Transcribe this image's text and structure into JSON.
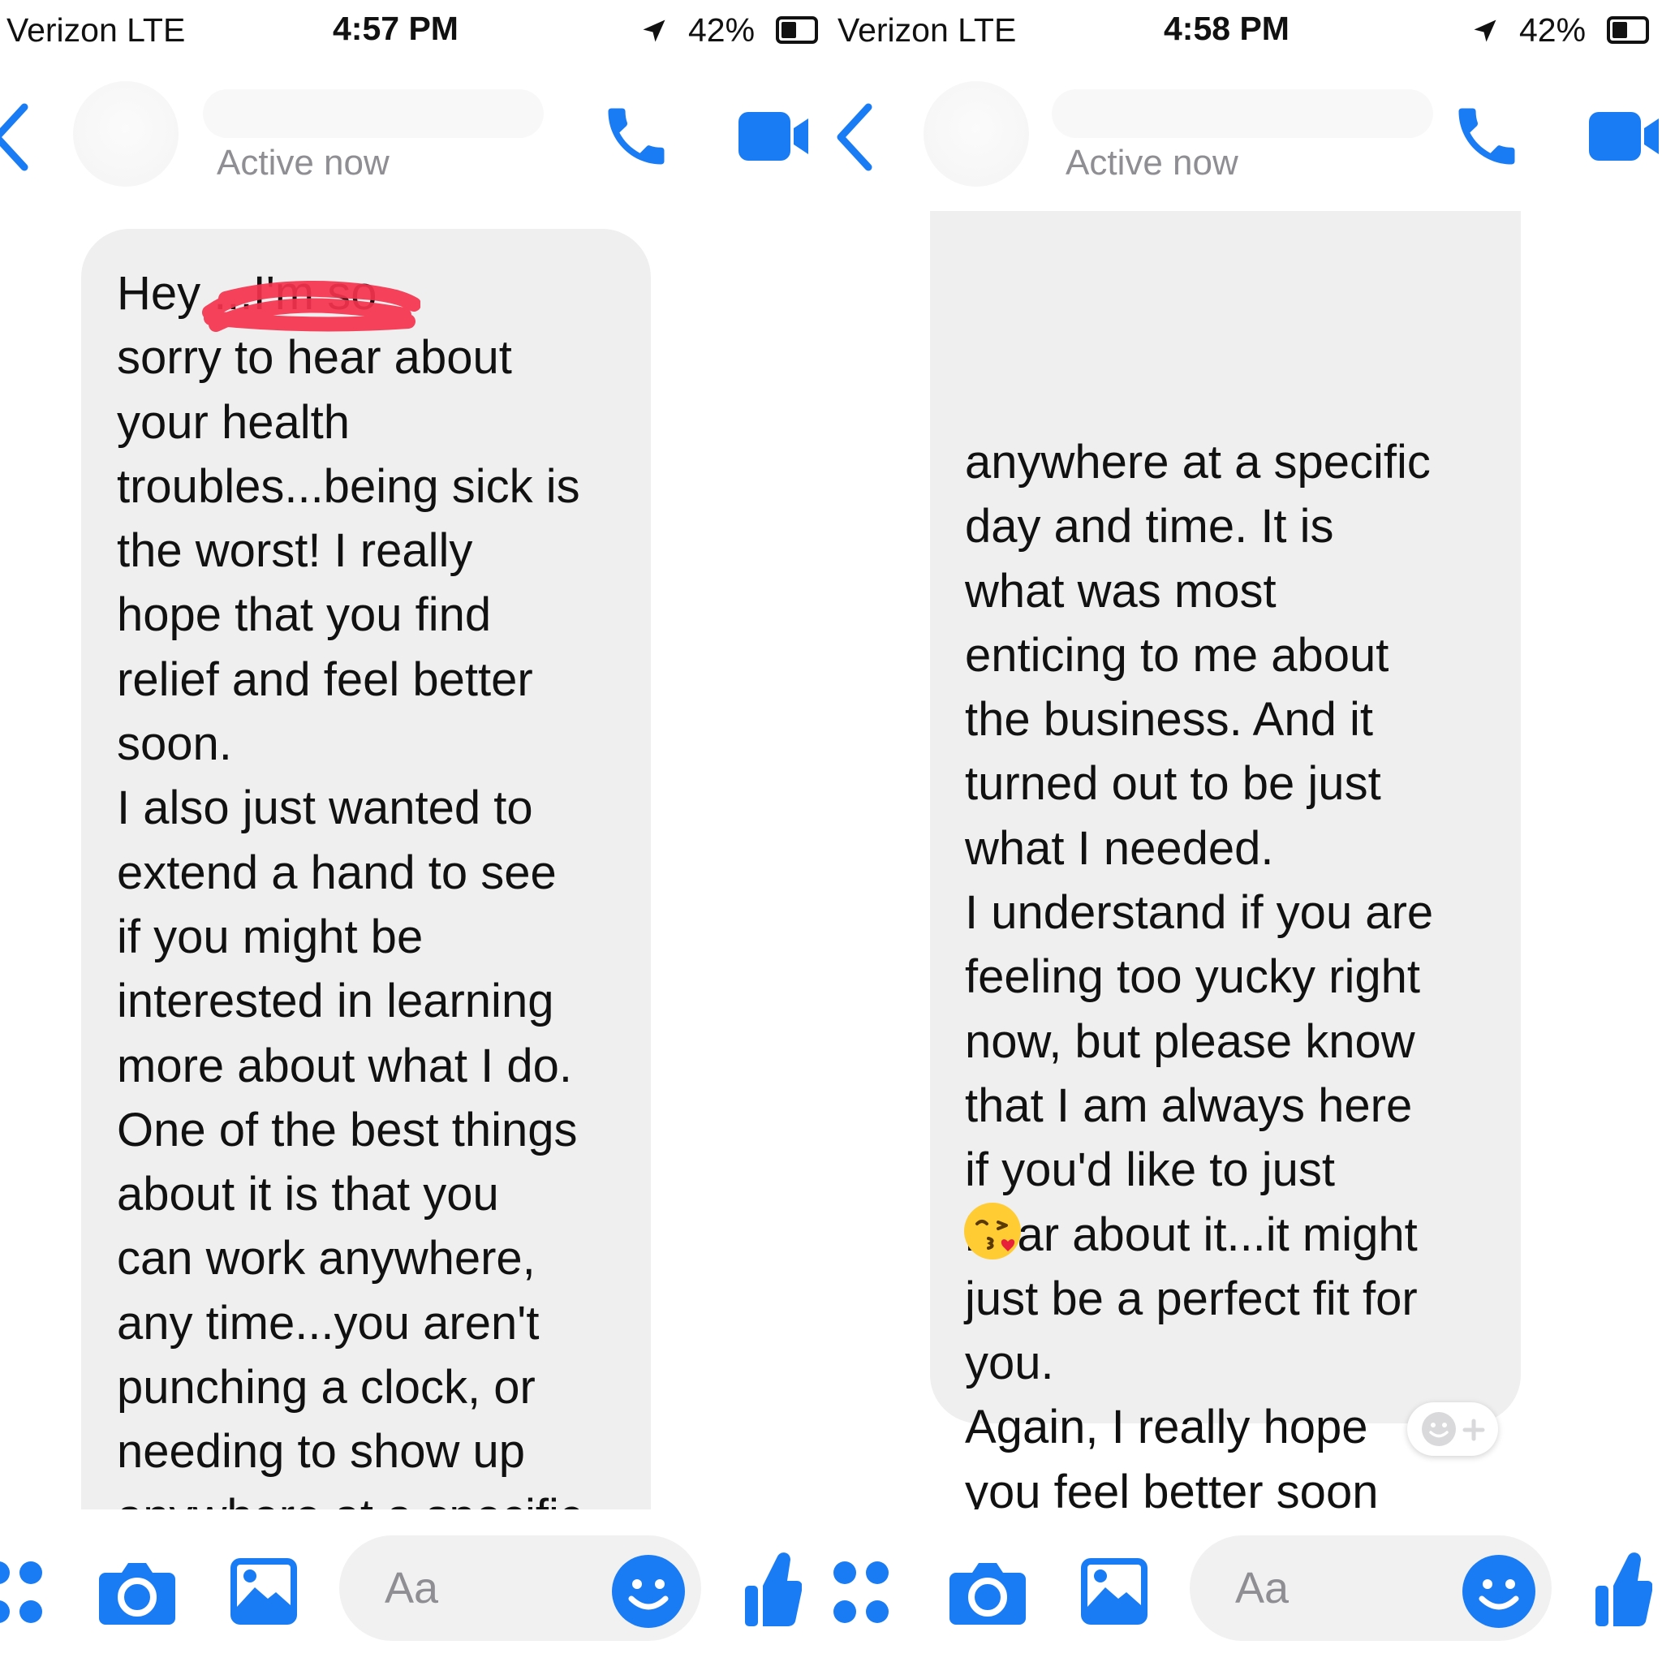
{
  "colors": {
    "accent": "#1a7cf5",
    "bubble": "#efefef",
    "muted": "#8e8e93"
  },
  "screens": [
    {
      "statusbar": {
        "carrier": "Verizon  LTE",
        "time": "4:57 PM",
        "battery": "42%"
      },
      "header": {
        "status": "Active now"
      },
      "message": {
        "text": "Hey         ...I'm so\nsorry to hear about\nyour health\ntroubles...being sick is\nthe worst! I really\nhope that you find\nrelief and feel better\nsoon.\nI also just wanted to\nextend a hand to see\nif you might be\ninterested in learning\nmore about what I do.\nOne of the best things\nabout it is that you\ncan work anywhere,\nany time...you aren't\npunching a clock, or\nneeding to show up\nanywhere at a specific"
      },
      "composer": {
        "placeholder": "Aa"
      }
    },
    {
      "statusbar": {
        "carrier": "Verizon  LTE",
        "time": "4:58 PM",
        "battery": "42%"
      },
      "header": {
        "status": "Active now"
      },
      "message": {
        "text": "anywhere at a specific\nday and time. It is\nwhat was most\nenticing to me about\nthe business. And it\nturned out to be just\nwhat I needed.\nI understand if you are\nfeeling too yucky right\nnow, but please know\nthat I am always here\nif you'd like to just\nhear about it...it might\njust be a perfect fit for\nyou.\nAgain, I really hope\nyou feel better soon"
      },
      "composer": {
        "placeholder": "Aa"
      }
    }
  ]
}
